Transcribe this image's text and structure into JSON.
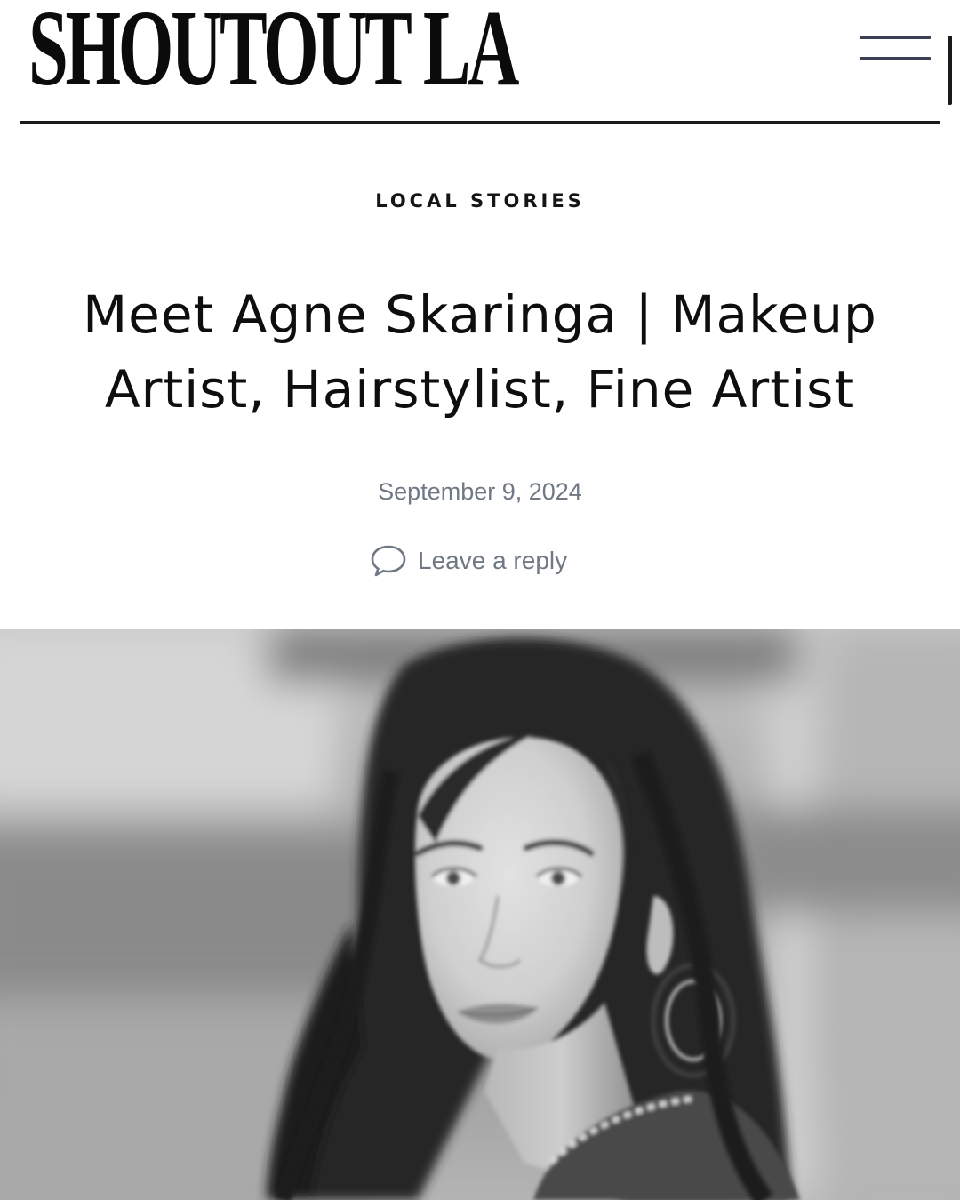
{
  "header": {
    "logo_text": "SHOUTOUT LA",
    "menu_icon": "hamburger-menu-icon"
  },
  "article": {
    "category": "LOCAL STORIES",
    "title": "Meet Agne Skaringa | Makeup Artist, Hairstylist, Fine Artist",
    "date": "September 9, 2024",
    "reply_label": "Leave a reply",
    "reply_icon": "comment-bubble-icon"
  },
  "featured_image": {
    "description": "black-and-white portrait photo"
  },
  "colors": {
    "text": "#111111",
    "meta": "#6f7884",
    "menu_lines": "#3a4152",
    "rule": "#1b1b1b"
  }
}
